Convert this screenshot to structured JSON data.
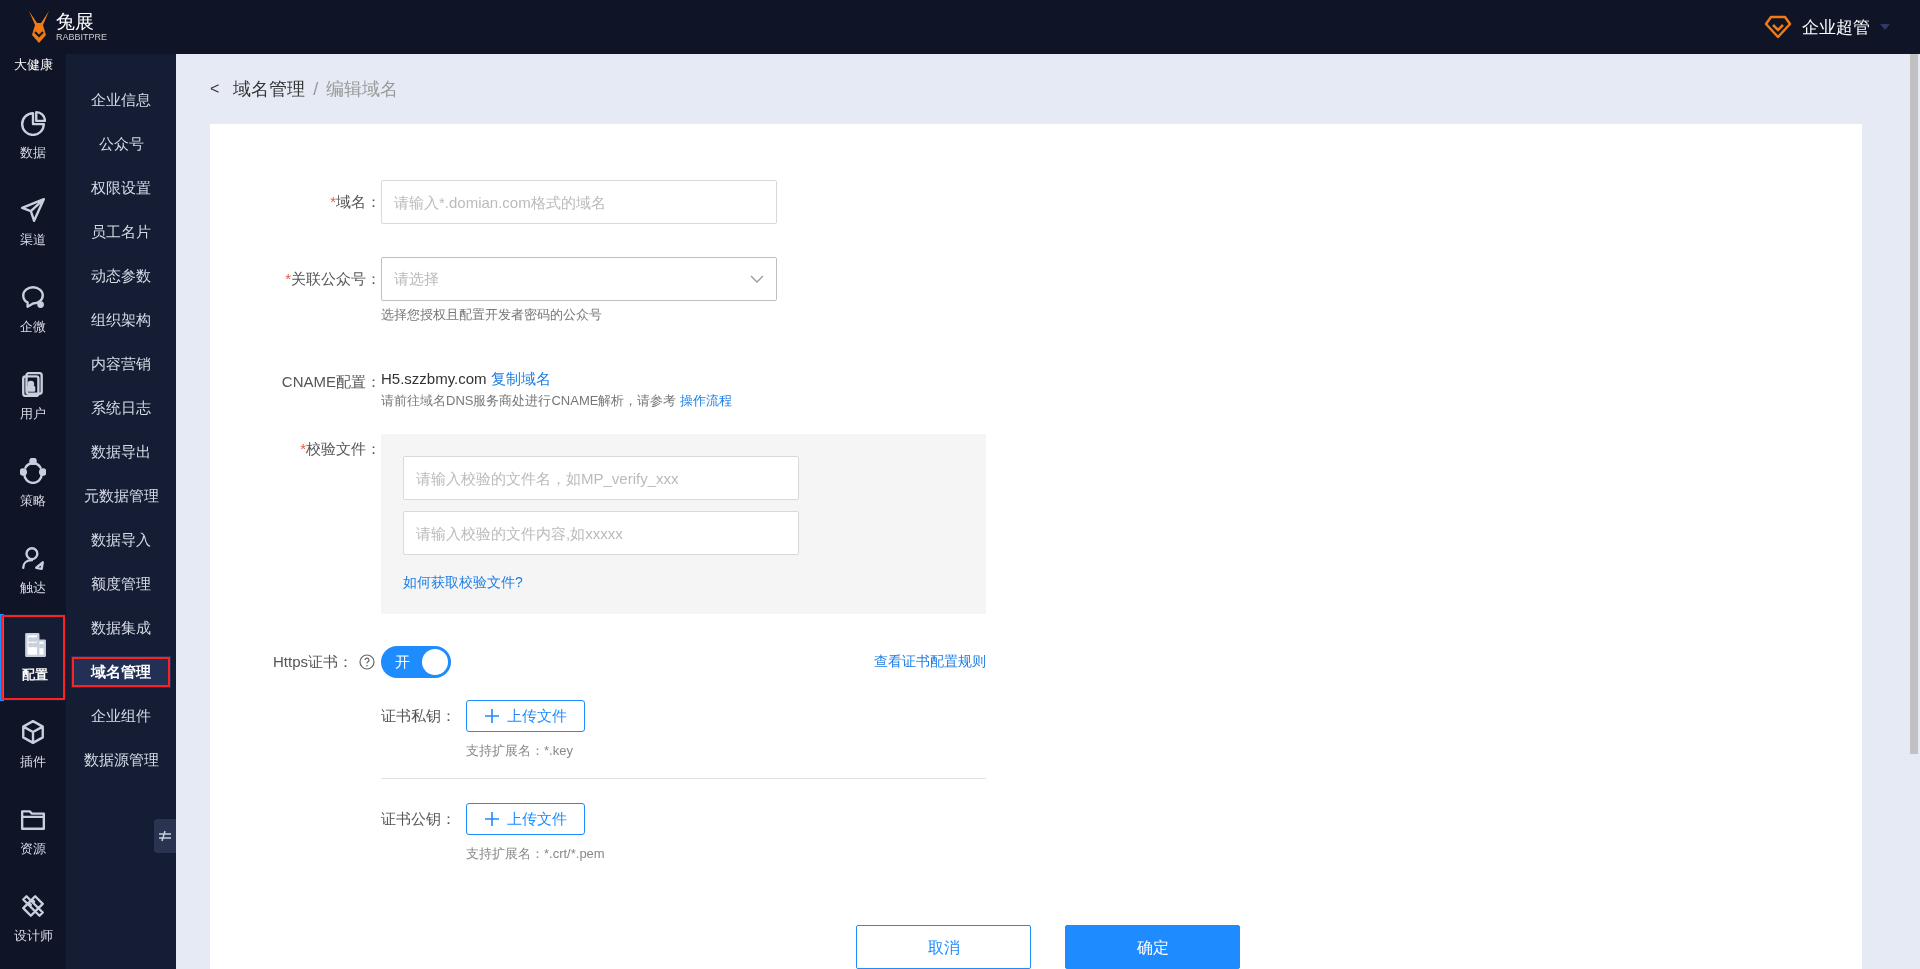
{
  "header": {
    "logo_text": "兔展",
    "logo_subtext": "RABBITPRE",
    "user": "企业超管"
  },
  "rail": {
    "top_label": "大健康",
    "items": [
      {
        "label": "数据",
        "selected": false,
        "highlighted": false
      },
      {
        "label": "渠道",
        "selected": false,
        "highlighted": false
      },
      {
        "label": "企微",
        "selected": false,
        "highlighted": false
      },
      {
        "label": "用户",
        "selected": false,
        "highlighted": false
      },
      {
        "label": "策略",
        "selected": false,
        "highlighted": false
      },
      {
        "label": "触达",
        "selected": false,
        "highlighted": false
      },
      {
        "label": "配置",
        "selected": true,
        "highlighted": true
      },
      {
        "label": "插件",
        "selected": false,
        "highlighted": false
      },
      {
        "label": "资源",
        "selected": false,
        "highlighted": false
      },
      {
        "label": "设计师",
        "selected": false,
        "highlighted": false
      }
    ]
  },
  "submenu": {
    "items": [
      {
        "label": "企业信息",
        "selected": false,
        "highlighted": false
      },
      {
        "label": "公众号",
        "selected": false,
        "highlighted": false
      },
      {
        "label": "权限设置",
        "selected": false,
        "highlighted": false
      },
      {
        "label": "员工名片",
        "selected": false,
        "highlighted": false
      },
      {
        "label": "动态参数",
        "selected": false,
        "highlighted": false
      },
      {
        "label": "组织架构",
        "selected": false,
        "highlighted": false
      },
      {
        "label": "内容营销",
        "selected": false,
        "highlighted": false
      },
      {
        "label": "系统日志",
        "selected": false,
        "highlighted": false
      },
      {
        "label": "数据导出",
        "selected": false,
        "highlighted": false
      },
      {
        "label": "元数据管理",
        "selected": false,
        "highlighted": false
      },
      {
        "label": "数据导入",
        "selected": false,
        "highlighted": false
      },
      {
        "label": "额度管理",
        "selected": false,
        "highlighted": false
      },
      {
        "label": "数据集成",
        "selected": false,
        "highlighted": false
      },
      {
        "label": "域名管理",
        "selected": true,
        "highlighted": true
      },
      {
        "label": "企业组件",
        "selected": false,
        "highlighted": false
      },
      {
        "label": "数据源管理",
        "selected": false,
        "highlighted": false
      }
    ]
  },
  "breadcrumb": {
    "back": "<",
    "parent": "域名管理",
    "separator": "/",
    "current": "编辑域名"
  },
  "form": {
    "domain": {
      "label": "域名：",
      "mark": "*",
      "placeholder": "请输入*.domian.com格式的域名"
    },
    "account": {
      "label": "关联公众号：",
      "mark": "*",
      "placeholder": "请选择",
      "hint": "选择您授权且配置开发者密码的公众号"
    },
    "cname": {
      "label": "CNAME配置：",
      "value": "H5.szzbmy.com",
      "copy_link": "复制域名",
      "hint": "请前往域名DNS服务商处进行CNAME解析，请参考",
      "hint_link": "操作流程"
    },
    "verify": {
      "label": "校验文件：",
      "mark": "*",
      "name_placeholder": "请输入校验的文件名，如MP_verify_xxx",
      "content_placeholder": "请输入校验的文件内容,如xxxxx",
      "help_link": "如何获取校验文件?"
    },
    "https": {
      "label": "Https证书：",
      "toggle_text": "开",
      "on": true,
      "rules_link": "查看证书配置规则",
      "uploads": [
        {
          "label": "证书私钥：",
          "button": "上传文件",
          "hint": "支持扩展名：*.key"
        },
        {
          "label": "证书公钥：",
          "button": "上传文件",
          "hint": "支持扩展名：*.crt/*.pem"
        }
      ]
    }
  },
  "actions": {
    "cancel": "取消",
    "confirm": "确定"
  }
}
